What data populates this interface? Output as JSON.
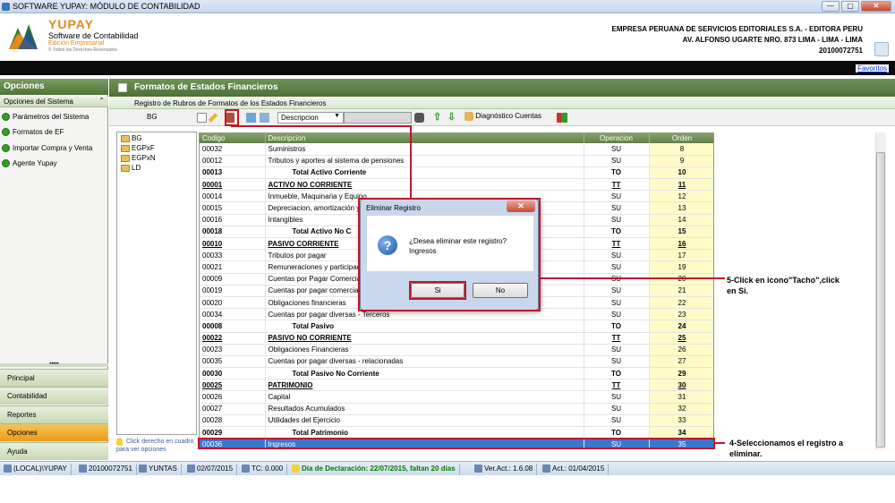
{
  "window": {
    "title": "SOFTWARE YUPAY: MÓDULO DE CONTABILIDAD",
    "minimize": "—",
    "maximize": "▢",
    "close": "✕"
  },
  "brand": {
    "name": "YUPAY",
    "product": "Software de Contabilidad",
    "edition": "Edición Empresarial",
    "tagline": "© Todos los Derechos Reservados"
  },
  "company": {
    "name": "EMPRESA PERUANA DE SERVICIOS EDITORIALES S.A. - EDITORA PERU",
    "address": "AV. ALFONSO UGARTE NRO. 873 LIMA - LIMA - LIMA",
    "ruc": "20100072751"
  },
  "favoritos": "Favoritos",
  "left": {
    "title": "Opciones",
    "section": "Opciones del Sistema",
    "items": [
      {
        "label": "Parámetros del Sistema"
      },
      {
        "label": "Formatos de EF"
      },
      {
        "label": "Importar Compra y Venta"
      },
      {
        "label": "Agente Yupay"
      }
    ],
    "nav": [
      "Principal",
      "Contabilidad",
      "Reportes",
      "Opciones",
      "Ayuda"
    ],
    "active_nav": "Opciones"
  },
  "main": {
    "title": "Formatos de Estados Financieros",
    "subtitle": "Registro de Rubros de Formatos de los Estados Financieros",
    "current_format": "BG",
    "combo_value": "Descripcion",
    "diag_label": "Diagnóstico Cuentas"
  },
  "tree": [
    "BG",
    "EGPxF",
    "EGPxN",
    "LD"
  ],
  "hint": "Click derecho en cuadro para ver opciones",
  "grid": {
    "headers": [
      "Codigo",
      "Descripcion",
      "Operacion",
      "Orden"
    ],
    "rows": [
      {
        "code": "00032",
        "desc": "Suministros",
        "op": "SU",
        "ord": "8",
        "style": "normal"
      },
      {
        "code": "00012",
        "desc": "Tributos y aportes al sistema de pensiones",
        "op": "SU",
        "ord": "9",
        "style": "normal"
      },
      {
        "code": "00013",
        "desc": "Total Activo Corriente",
        "op": "TO",
        "ord": "10",
        "style": "total"
      },
      {
        "code": "00001",
        "desc": "ACTIVO NO CORRIENTE",
        "op": "TT",
        "ord": "11",
        "style": "title"
      },
      {
        "code": "00014",
        "desc": "Inmueble, Maquinaria y Equipo",
        "op": "SU",
        "ord": "12",
        "style": "normal"
      },
      {
        "code": "00015",
        "desc": "Depreciacion, amortización y a",
        "op": "SU",
        "ord": "13",
        "style": "normal"
      },
      {
        "code": "00016",
        "desc": "Intangibles",
        "op": "SU",
        "ord": "14",
        "style": "normal"
      },
      {
        "code": "00018",
        "desc": "Total Activo No C",
        "op": "TO",
        "ord": "15",
        "style": "total"
      },
      {
        "code": "00010",
        "desc": "PASIVO CORRIENTE",
        "op": "TT",
        "ord": "16",
        "style": "title"
      },
      {
        "code": "00033",
        "desc": "Tributos por pagar",
        "op": "SU",
        "ord": "17",
        "style": "normal"
      },
      {
        "code": "00021",
        "desc": "Remuneraciones y participació",
        "op": "SU",
        "ord": "19",
        "style": "normal"
      },
      {
        "code": "00009",
        "desc": "Cuentas por Pagar Comerciale",
        "op": "SU",
        "ord": "20",
        "style": "normal"
      },
      {
        "code": "00019",
        "desc": "Cuentas por pagar comerciale",
        "op": "SU",
        "ord": "21",
        "style": "normal"
      },
      {
        "code": "00020",
        "desc": "Obligaciones financieras",
        "op": "SU",
        "ord": "22",
        "style": "normal"
      },
      {
        "code": "00034",
        "desc": "Cuentas por pagar diversas - Terceros",
        "op": "SU",
        "ord": "23",
        "style": "normal"
      },
      {
        "code": "00008",
        "desc": "Total Pasivo",
        "op": "TO",
        "ord": "24",
        "style": "total"
      },
      {
        "code": "00022",
        "desc": "PASIVO NO CORRIENTE",
        "op": "TT",
        "ord": "25",
        "style": "title"
      },
      {
        "code": "00023",
        "desc": "Obligaciones Financieras",
        "op": "SU",
        "ord": "26",
        "style": "normal"
      },
      {
        "code": "00035",
        "desc": "Cuentas por pagar diversas - relacionadas",
        "op": "SU",
        "ord": "27",
        "style": "normal"
      },
      {
        "code": "00030",
        "desc": "Total Pasivo No Corriente",
        "op": "TO",
        "ord": "29",
        "style": "total"
      },
      {
        "code": "00025",
        "desc": "PATRIMONIO",
        "op": "TT",
        "ord": "30",
        "style": "title"
      },
      {
        "code": "00026",
        "desc": "Capital",
        "op": "SU",
        "ord": "31",
        "style": "normal"
      },
      {
        "code": "00027",
        "desc": "Resultados Acumulados",
        "op": "SU",
        "ord": "32",
        "style": "normal"
      },
      {
        "code": "00028",
        "desc": "Utilidades del Ejercicio",
        "op": "SU",
        "ord": "33",
        "style": "normal"
      },
      {
        "code": "00029",
        "desc": "Total Patrimonio",
        "op": "TO",
        "ord": "34",
        "style": "total"
      },
      {
        "code": "00036",
        "desc": "Ingresos",
        "op": "SU",
        "ord": "35",
        "style": "selected"
      }
    ]
  },
  "dialog": {
    "title": "Eliminar Registro",
    "close": "✕",
    "message_line1": "¿Desea eliminar este registro?",
    "message_line2": "Ingresos",
    "yes": "Si",
    "no": "No"
  },
  "annotations": {
    "step5_line1": "5-Click en icono\"Tacho\",click",
    "step5_line2": "en Si.",
    "step4_line1": "4-Seleccionamos el registro a",
    "step4_line2": "eliminar."
  },
  "status": {
    "server": "(LOCAL)\\YUPAY",
    "ruc": "20100072751",
    "user": "YUNTAS",
    "date": "02/07/2015",
    "tc": "TC: 0.000",
    "declaration": "Día de Declaración: 22/07/2015, faltan 20 días",
    "version": "Ver.Act.: 1.6.08",
    "act": "Act.: 01/04/2015"
  },
  "colors": {
    "header_green": "#4f7338",
    "highlight_red": "#c2162c",
    "selection_blue": "#3a78cf",
    "orden_yellow": "#fffbc8",
    "active_nav": "#ef9b16"
  }
}
